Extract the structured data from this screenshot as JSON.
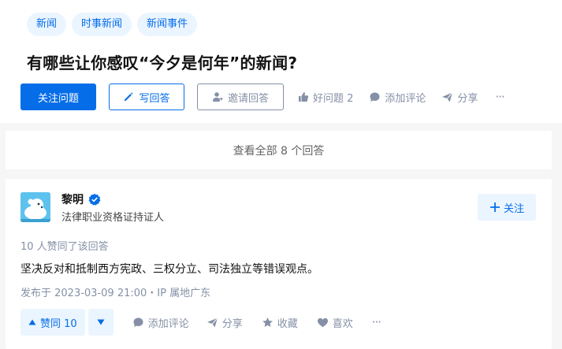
{
  "question": {
    "tags": [
      "新闻",
      "时事新闻",
      "新闻事件"
    ],
    "title": "有哪些让你感叹“今夕是何年”的新闻?",
    "follow_label": "关注问题",
    "write_answer_label": "写回答",
    "invite_label": "邀请回答",
    "good_question_label": "好问题 2",
    "add_comment_label": "添加评论",
    "share_label": "分享",
    "more_label": "···"
  },
  "view_all_label": "查看全部 8 个回答",
  "answer": {
    "author_name": "黎明",
    "author_desc": "法律职业资格证持证人",
    "follow_label": "关注",
    "votes_text": "10 人赞同了该回答",
    "content": "坚决反对和抵制西方宪政、三权分立、司法独立等错误观点。",
    "time_text": "发布于 2023-03-09 21:00・IP 属地广东",
    "upvote_label": "赞同 10",
    "add_comment_label": "添加评论",
    "share_label": "分享",
    "collect_label": "收藏",
    "like_label": "喜欢",
    "more_label": "···"
  },
  "colors": {
    "brand_blue": "#056de8",
    "light_blue": "#ebf5ff",
    "muted": "#8590a6"
  }
}
